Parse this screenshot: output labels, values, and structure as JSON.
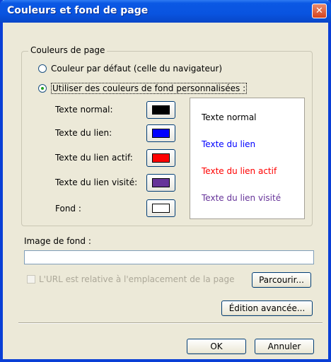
{
  "window": {
    "title": "Couleurs et fond de page",
    "close_glyph": "✕"
  },
  "group": {
    "legend": "Couleurs de page",
    "radio_default": "Couleur par défaut (celle du navigateur)",
    "radio_custom": "Utiliser des couleurs de fond personnalisées :",
    "selected": "custom"
  },
  "colors": {
    "normal_label": "Texte normal:",
    "link_label": "Texte du lien:",
    "active_label": "Texte du lien actif:",
    "visited_label": "Texte du lien visité:",
    "background_label": "Fond :",
    "normal_color": "#000000",
    "link_color": "#0000ff",
    "active_color": "#ff0000",
    "visited_color": "#663399",
    "background_color": "#ffffff"
  },
  "preview": {
    "normal": "Texte normal",
    "link": "Texte du lien",
    "active": "Texte du lien actif",
    "visited": "Texte du lien visité"
  },
  "background_image": {
    "label": "Image de fond :",
    "value": "",
    "relative_url_label": "L'URL est relative à l'emplacement de la page",
    "relative_url_checked": false,
    "browse_button": "Parcourir..."
  },
  "buttons": {
    "advanced_edit": "Édition avancée...",
    "ok": "OK",
    "cancel": "Annuler"
  }
}
